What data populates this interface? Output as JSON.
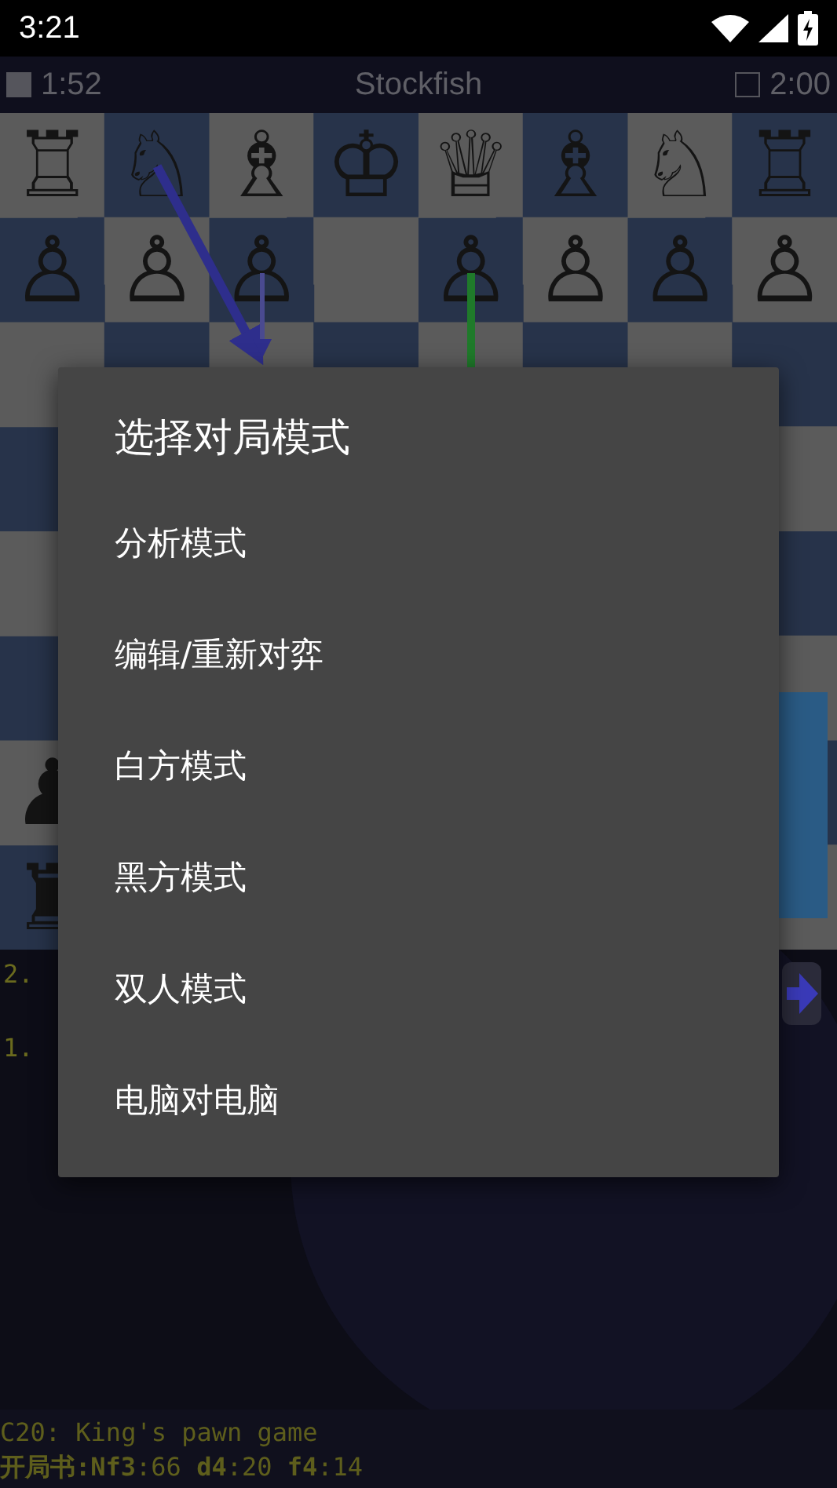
{
  "status_bar": {
    "time": "3:21"
  },
  "title_bar": {
    "title": "Stockfish",
    "clocks": [
      {
        "time": "1:52",
        "active": true
      },
      {
        "time": "2:00",
        "active": false
      }
    ]
  },
  "board": {
    "ranks": [
      [
        {
          "kind": "piece",
          "glyph": "♖"
        },
        {
          "kind": "piece",
          "glyph": "♘"
        },
        {
          "kind": "piece",
          "glyph": "♗"
        },
        {
          "kind": "piece",
          "glyph": "♔"
        },
        {
          "kind": "piece",
          "glyph": "♕"
        },
        {
          "kind": "piece",
          "glyph": "♗"
        },
        {
          "kind": "piece",
          "glyph": "♘"
        },
        {
          "kind": "piece",
          "glyph": "♖"
        }
      ],
      [
        {
          "kind": "piece",
          "glyph": "♙"
        },
        {
          "kind": "piece",
          "glyph": "♙"
        },
        {
          "kind": "piece",
          "glyph": "♙"
        },
        {
          "kind": "empty"
        },
        {
          "kind": "piece",
          "glyph": "♙"
        },
        {
          "kind": "piece",
          "glyph": "♙"
        },
        {
          "kind": "piece",
          "glyph": "♙"
        },
        {
          "kind": "piece",
          "glyph": "♙"
        }
      ],
      [
        {
          "kind": "empty"
        },
        {
          "kind": "empty"
        },
        {
          "kind": "empty"
        },
        {
          "kind": "empty"
        },
        {
          "kind": "empty"
        },
        {
          "kind": "empty"
        },
        {
          "kind": "empty"
        },
        {
          "kind": "empty"
        }
      ],
      [
        {
          "kind": "empty"
        },
        {
          "kind": "empty"
        },
        {
          "kind": "empty"
        },
        {
          "kind": "empty"
        },
        {
          "kind": "empty"
        },
        {
          "kind": "empty"
        },
        {
          "kind": "empty"
        },
        {
          "kind": "empty"
        }
      ],
      [
        {
          "kind": "empty"
        },
        {
          "kind": "empty"
        },
        {
          "kind": "empty"
        },
        {
          "kind": "empty"
        },
        {
          "kind": "empty"
        },
        {
          "kind": "empty"
        },
        {
          "kind": "empty"
        },
        {
          "kind": "empty"
        }
      ],
      [
        {
          "kind": "empty"
        },
        {
          "kind": "empty"
        },
        {
          "kind": "empty"
        },
        {
          "kind": "empty"
        },
        {
          "kind": "empty"
        },
        {
          "kind": "empty"
        },
        {
          "kind": "empty"
        },
        {
          "kind": "empty"
        }
      ],
      [
        {
          "kind": "piece",
          "glyph": "♟"
        },
        {
          "kind": "empty"
        },
        {
          "kind": "empty"
        },
        {
          "kind": "empty"
        },
        {
          "kind": "empty"
        },
        {
          "kind": "empty"
        },
        {
          "kind": "empty"
        },
        {
          "kind": "empty"
        }
      ],
      [
        {
          "kind": "piece",
          "glyph": "♜"
        },
        {
          "kind": "empty"
        },
        {
          "kind": "empty"
        },
        {
          "kind": "empty"
        },
        {
          "kind": "empty"
        },
        {
          "kind": "empty"
        },
        {
          "kind": "empty"
        },
        {
          "kind": "empty"
        }
      ]
    ]
  },
  "moves": [
    "2.",
    "1."
  ],
  "opening": {
    "name": "C20: King's pawn game",
    "book": "**开局书:Nf3**:66 **d4**:20 **f4**:14"
  },
  "dialog": {
    "title": "选择对局模式",
    "items": [
      "分析模式",
      "编辑/重新对弈",
      "白方模式",
      "黑方模式",
      "双人模式",
      "电脑对电脑"
    ]
  }
}
